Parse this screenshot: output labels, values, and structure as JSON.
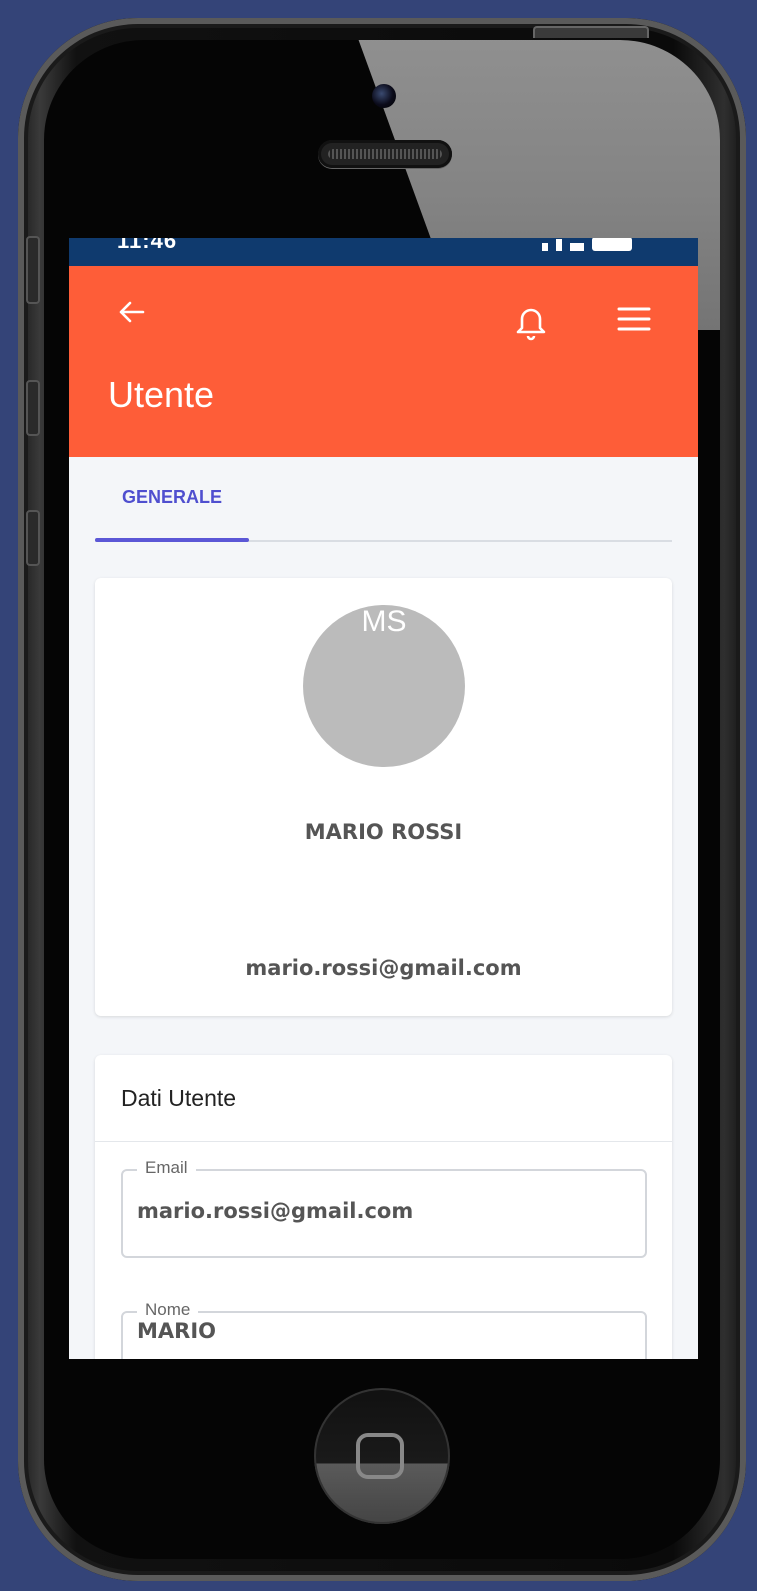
{
  "status_bar": {
    "time": "11:46"
  },
  "app_bar": {
    "title": "Utente"
  },
  "tabs": [
    {
      "label": "GENERALE",
      "active": true
    }
  ],
  "profile": {
    "initials": "MS",
    "full_name": "MARIO ROSSI",
    "email": "mario.rossi@gmail.com"
  },
  "details": {
    "title": "Dati Utente",
    "fields": [
      {
        "label": "Email",
        "value": "mario.rossi@gmail.com"
      },
      {
        "label": "Nome",
        "value": "MARIO"
      }
    ]
  },
  "colors": {
    "background": "#344478",
    "status_bar": "#0f3a6e",
    "app_bar": "#fe5d38",
    "tab_accent": "#5b57d6",
    "avatar": "#bbbbbb"
  },
  "icons": [
    "back-arrow-icon",
    "bell-icon",
    "hamburger-menu-icon"
  ]
}
